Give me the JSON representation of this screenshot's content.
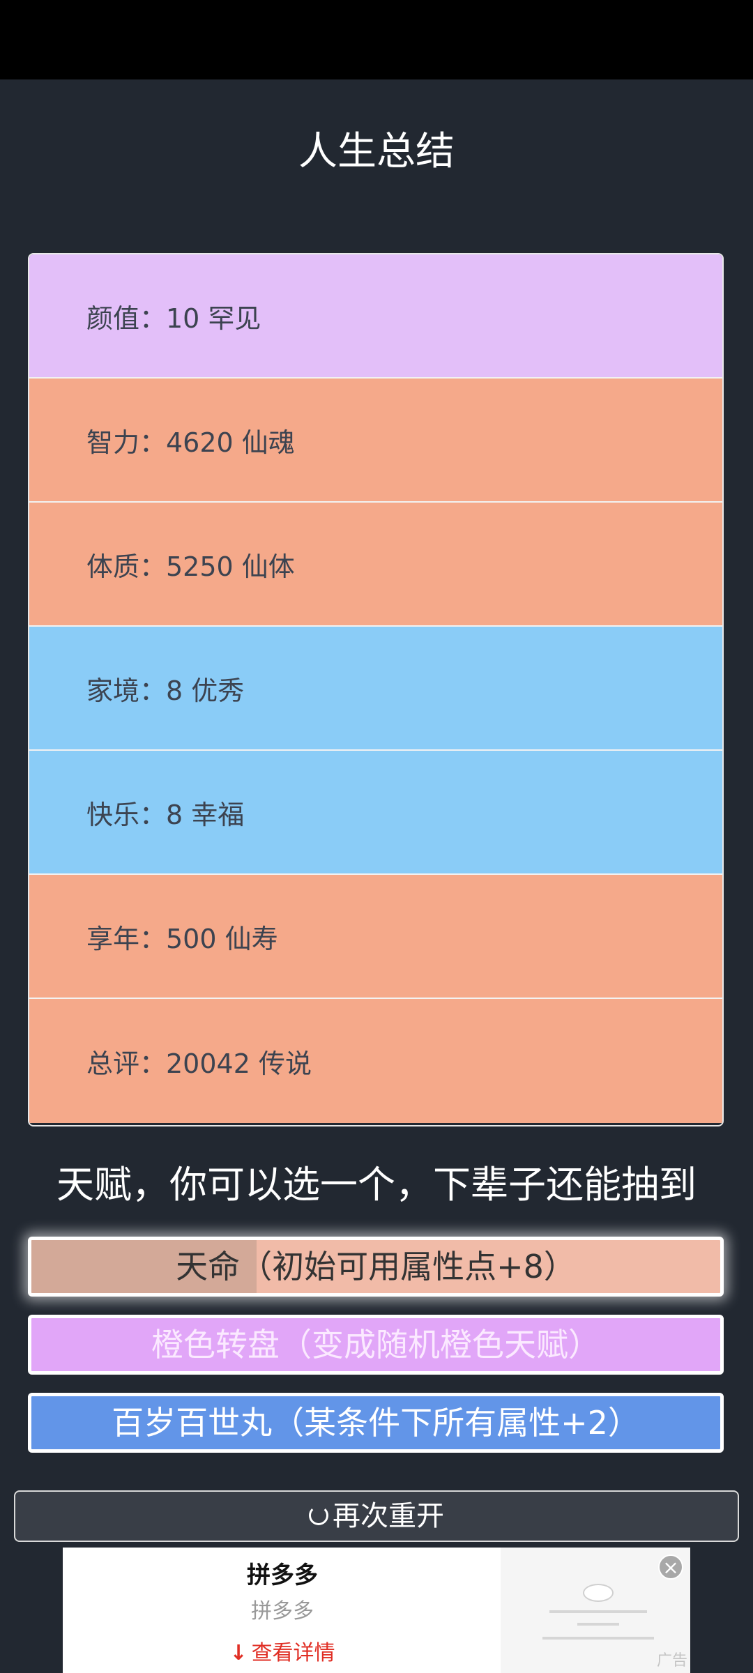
{
  "page": {
    "title": "人生总结"
  },
  "summary": {
    "rows": [
      {
        "label": "颜值：10 罕见",
        "color": "#e3bff9"
      },
      {
        "label": "智力：4620 仙魂",
        "color": "#f5a98a"
      },
      {
        "label": "体质：5250 仙体",
        "color": "#f5a98a"
      },
      {
        "label": "家境：8 优秀",
        "color": "#8accf7"
      },
      {
        "label": "快乐：8 幸福",
        "color": "#8accf7"
      },
      {
        "label": "享年：500 仙寿",
        "color": "#f5a98a"
      },
      {
        "label": "总评：20042 传说",
        "color": "#f5a98a"
      }
    ]
  },
  "talents": {
    "heading": "天赋，你可以选一个，下辈子还能抽到",
    "items": [
      {
        "label": "天命（初始可用属性点+8）",
        "color": "#f1bba8"
      },
      {
        "label": "橙色转盘（变成随机橙色天赋）",
        "color": "#e1a6f8"
      },
      {
        "label": "百岁百世丸（某条件下所有属性+2）",
        "color": "#6295e8"
      }
    ]
  },
  "restart": {
    "label": "再次重开",
    "icon": "refresh-icon"
  },
  "ad": {
    "title": "拼多多",
    "subtitle": "拼多多",
    "cta": "查看详情",
    "cta_icon": "download-arrow-icon",
    "label": "广告",
    "close_icon": "close-icon"
  }
}
